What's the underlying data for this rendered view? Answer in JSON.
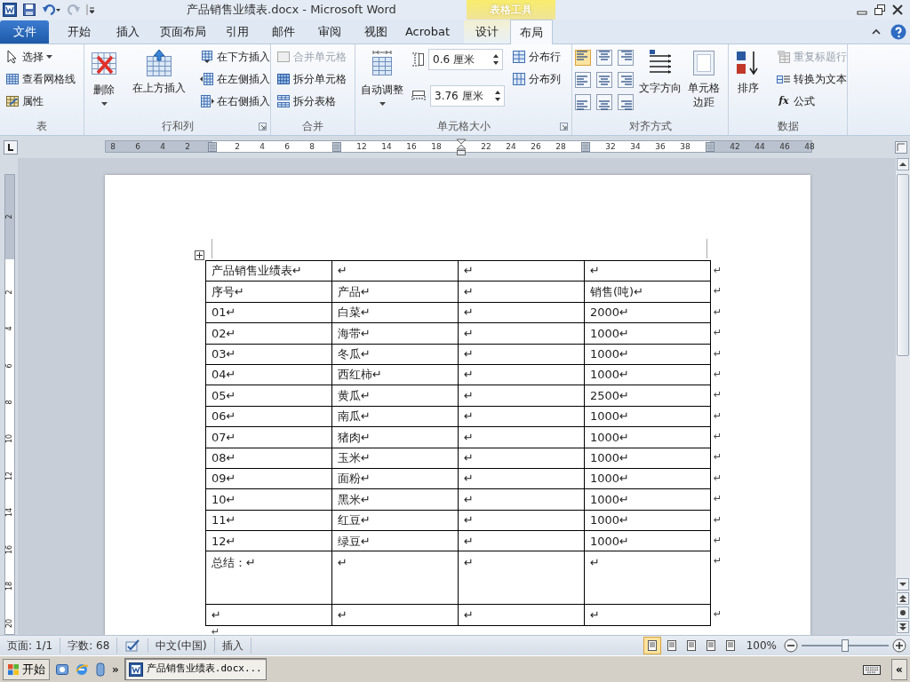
{
  "title": "产品销售业绩表.docx - Microsoft Word",
  "context_group": "表格工具",
  "tabs": [
    {
      "label": "文件",
      "kind": "file",
      "selected": false
    },
    {
      "label": "开始",
      "kind": "normal",
      "selected": false
    },
    {
      "label": "插入",
      "kind": "normal",
      "selected": false
    },
    {
      "label": "页面布局",
      "kind": "normal",
      "selected": false
    },
    {
      "label": "引用",
      "kind": "normal",
      "selected": false
    },
    {
      "label": "邮件",
      "kind": "normal",
      "selected": false
    },
    {
      "label": "审阅",
      "kind": "normal",
      "selected": false
    },
    {
      "label": "视图",
      "kind": "normal",
      "selected": false
    },
    {
      "label": "Acrobat",
      "kind": "normal",
      "selected": false
    },
    {
      "label": "设计",
      "kind": "context",
      "selected": false
    },
    {
      "label": "布局",
      "kind": "context",
      "selected": true
    }
  ],
  "ribbon": {
    "groups": [
      {
        "name": "表",
        "launcher": false,
        "columns": [
          [
            {
              "kind": "small",
              "label": "选择",
              "dropdown": true,
              "disabled": false
            },
            {
              "kind": "small",
              "label": "查看网格线",
              "dropdown": false,
              "disabled": false
            },
            {
              "kind": "small",
              "label": "属性",
              "dropdown": false,
              "disabled": false
            }
          ]
        ]
      },
      {
        "name": "行和列",
        "launcher": true,
        "columns": [
          [
            {
              "kind": "large",
              "label": "删除",
              "dropdown": true,
              "disabled": false
            }
          ],
          [
            {
              "kind": "large",
              "label": "在上方插入",
              "dropdown": false,
              "disabled": false
            }
          ],
          [
            {
              "kind": "small",
              "label": "在下方插入",
              "dropdown": false,
              "disabled": false
            },
            {
              "kind": "small",
              "label": "在左侧插入",
              "dropdown": false,
              "disabled": false
            },
            {
              "kind": "small",
              "label": "在右侧插入",
              "dropdown": false,
              "disabled": false
            }
          ]
        ]
      },
      {
        "name": "合并",
        "launcher": false,
        "columns": [
          [
            {
              "kind": "small",
              "label": "合并单元格",
              "dropdown": false,
              "disabled": true
            },
            {
              "kind": "small",
              "label": "拆分单元格",
              "dropdown": false,
              "disabled": false
            },
            {
              "kind": "small",
              "label": "拆分表格",
              "dropdown": false,
              "disabled": false
            }
          ]
        ]
      },
      {
        "name": "单元格大小",
        "launcher": true,
        "columns": [
          [
            {
              "kind": "large",
              "label": "自动调整",
              "dropdown": true,
              "disabled": false
            }
          ],
          [
            {
              "kind": "spin",
              "value": "0.6 厘米"
            },
            {
              "kind": "spin",
              "value": "3.76 厘米"
            }
          ],
          [
            {
              "kind": "small",
              "label": "分布行",
              "dropdown": false,
              "disabled": false
            },
            {
              "kind": "small",
              "label": "分布列",
              "dropdown": false,
              "disabled": false
            }
          ]
        ]
      },
      {
        "name": "对齐方式",
        "launcher": false,
        "columns": [
          [
            {
              "kind": "align",
              "cells": [
                {
                  "selected": true
                },
                {
                  "selected": false
                },
                {
                  "selected": false
                },
                {
                  "selected": false
                },
                {
                  "selected": false
                },
                {
                  "selected": false
                },
                {
                  "selected": false
                },
                {
                  "selected": false
                },
                {
                  "selected": false
                }
              ]
            }
          ],
          [
            {
              "kind": "large",
              "label": "文字方向",
              "dropdown": false,
              "disabled": false
            }
          ],
          [
            {
              "kind": "large",
              "label": "单元格边距",
              "dropdown": false,
              "disabled": false
            }
          ]
        ]
      },
      {
        "name": "数据",
        "launcher": false,
        "columns": [
          [
            {
              "kind": "large",
              "label": "排序",
              "dropdown": false,
              "disabled": false
            }
          ],
          [
            {
              "kind": "small",
              "label": "重复标题行",
              "dropdown": false,
              "disabled": true
            },
            {
              "kind": "small",
              "label": "转换为文本",
              "dropdown": false,
              "disabled": false
            },
            {
              "kind": "small",
              "label": "公式",
              "symbol": "fx",
              "dropdown": false,
              "disabled": false
            }
          ]
        ]
      }
    ]
  },
  "ruler": {
    "labels": [
      "8",
      "6",
      "4",
      "2",
      "2",
      "4",
      "6",
      "8",
      "12",
      "14",
      "16",
      "18",
      "22",
      "24",
      "26",
      "28",
      "32",
      "34",
      "36",
      "38",
      "42",
      "44",
      "46",
      "48"
    ]
  },
  "vertical_ruler": {
    "labels": [
      "2",
      "2",
      "4",
      "6",
      "8",
      "10",
      "12",
      "14",
      "16",
      "18",
      "20"
    ]
  },
  "table": {
    "rows": [
      {
        "kind": "normal",
        "cells": [
          "产品销售业绩表↵",
          "↵",
          "↵",
          "↵"
        ],
        "end": "↵"
      },
      {
        "kind": "normal",
        "cells": [
          "序号↵",
          "产品↵",
          "↵",
          "销售(吨)↵"
        ],
        "end": "↵"
      },
      {
        "kind": "normal",
        "cells": [
          "01↵",
          "白菜↵",
          "↵",
          "2000↵"
        ],
        "end": "↵"
      },
      {
        "kind": "normal",
        "cells": [
          "02↵",
          "海带↵",
          "↵",
          "1000↵"
        ],
        "end": "↵"
      },
      {
        "kind": "normal",
        "cells": [
          "03↵",
          "冬瓜↵",
          "↵",
          "1000↵"
        ],
        "end": "↵"
      },
      {
        "kind": "normal",
        "cells": [
          "04↵",
          "西红柿↵",
          "↵",
          "1000↵"
        ],
        "end": "↵"
      },
      {
        "kind": "normal",
        "cells": [
          "05↵",
          "黄瓜↵",
          "↵",
          "2500↵"
        ],
        "end": "↵"
      },
      {
        "kind": "normal",
        "cells": [
          "06↵",
          "南瓜↵",
          "↵",
          "1000↵"
        ],
        "end": "↵"
      },
      {
        "kind": "normal",
        "cells": [
          "07↵",
          "猪肉↵",
          "↵",
          "1000↵"
        ],
        "end": "↵"
      },
      {
        "kind": "normal",
        "cells": [
          "08↵",
          "玉米↵",
          "↵",
          "1000↵"
        ],
        "end": "↵"
      },
      {
        "kind": "normal",
        "cells": [
          "09↵",
          "面粉↵",
          "↵",
          "1000↵"
        ],
        "end": "↵"
      },
      {
        "kind": "normal",
        "cells": [
          "10↵",
          "黑米↵",
          "↵",
          "1000↵"
        ],
        "end": "↵"
      },
      {
        "kind": "normal",
        "cells": [
          "11↵",
          "红豆↵",
          "↵",
          "1000↵"
        ],
        "end": "↵"
      },
      {
        "kind": "normal",
        "cells": [
          "12↵",
          "绿豆↵",
          "↵",
          "1000↵"
        ],
        "end": "↵"
      },
      {
        "kind": "tall",
        "cells": [
          "总结：↵",
          "↵",
          "↵",
          "↵"
        ],
        "end": "↵"
      },
      {
        "kind": "normal",
        "cells": [
          "↵",
          "↵",
          "↵",
          "↵"
        ],
        "end": "↵"
      }
    ]
  },
  "after_table": "↵",
  "status_bar": {
    "items": [
      "页面: 1/1",
      "字数: 68"
    ],
    "language": "中文(中国)",
    "mode": "插入",
    "views": [
      {
        "selected": true
      },
      {
        "selected": false
      },
      {
        "selected": false
      },
      {
        "selected": false
      },
      {
        "selected": false
      }
    ],
    "zoom": "100%",
    "zoom_slider": {
      "level": 0.5
    }
  },
  "taskbar": {
    "start": "开始",
    "more": "»",
    "windows": [
      {
        "label": "产品销售业绩表.docx...",
        "selected": true
      }
    ],
    "tray_toggle": "«"
  }
}
